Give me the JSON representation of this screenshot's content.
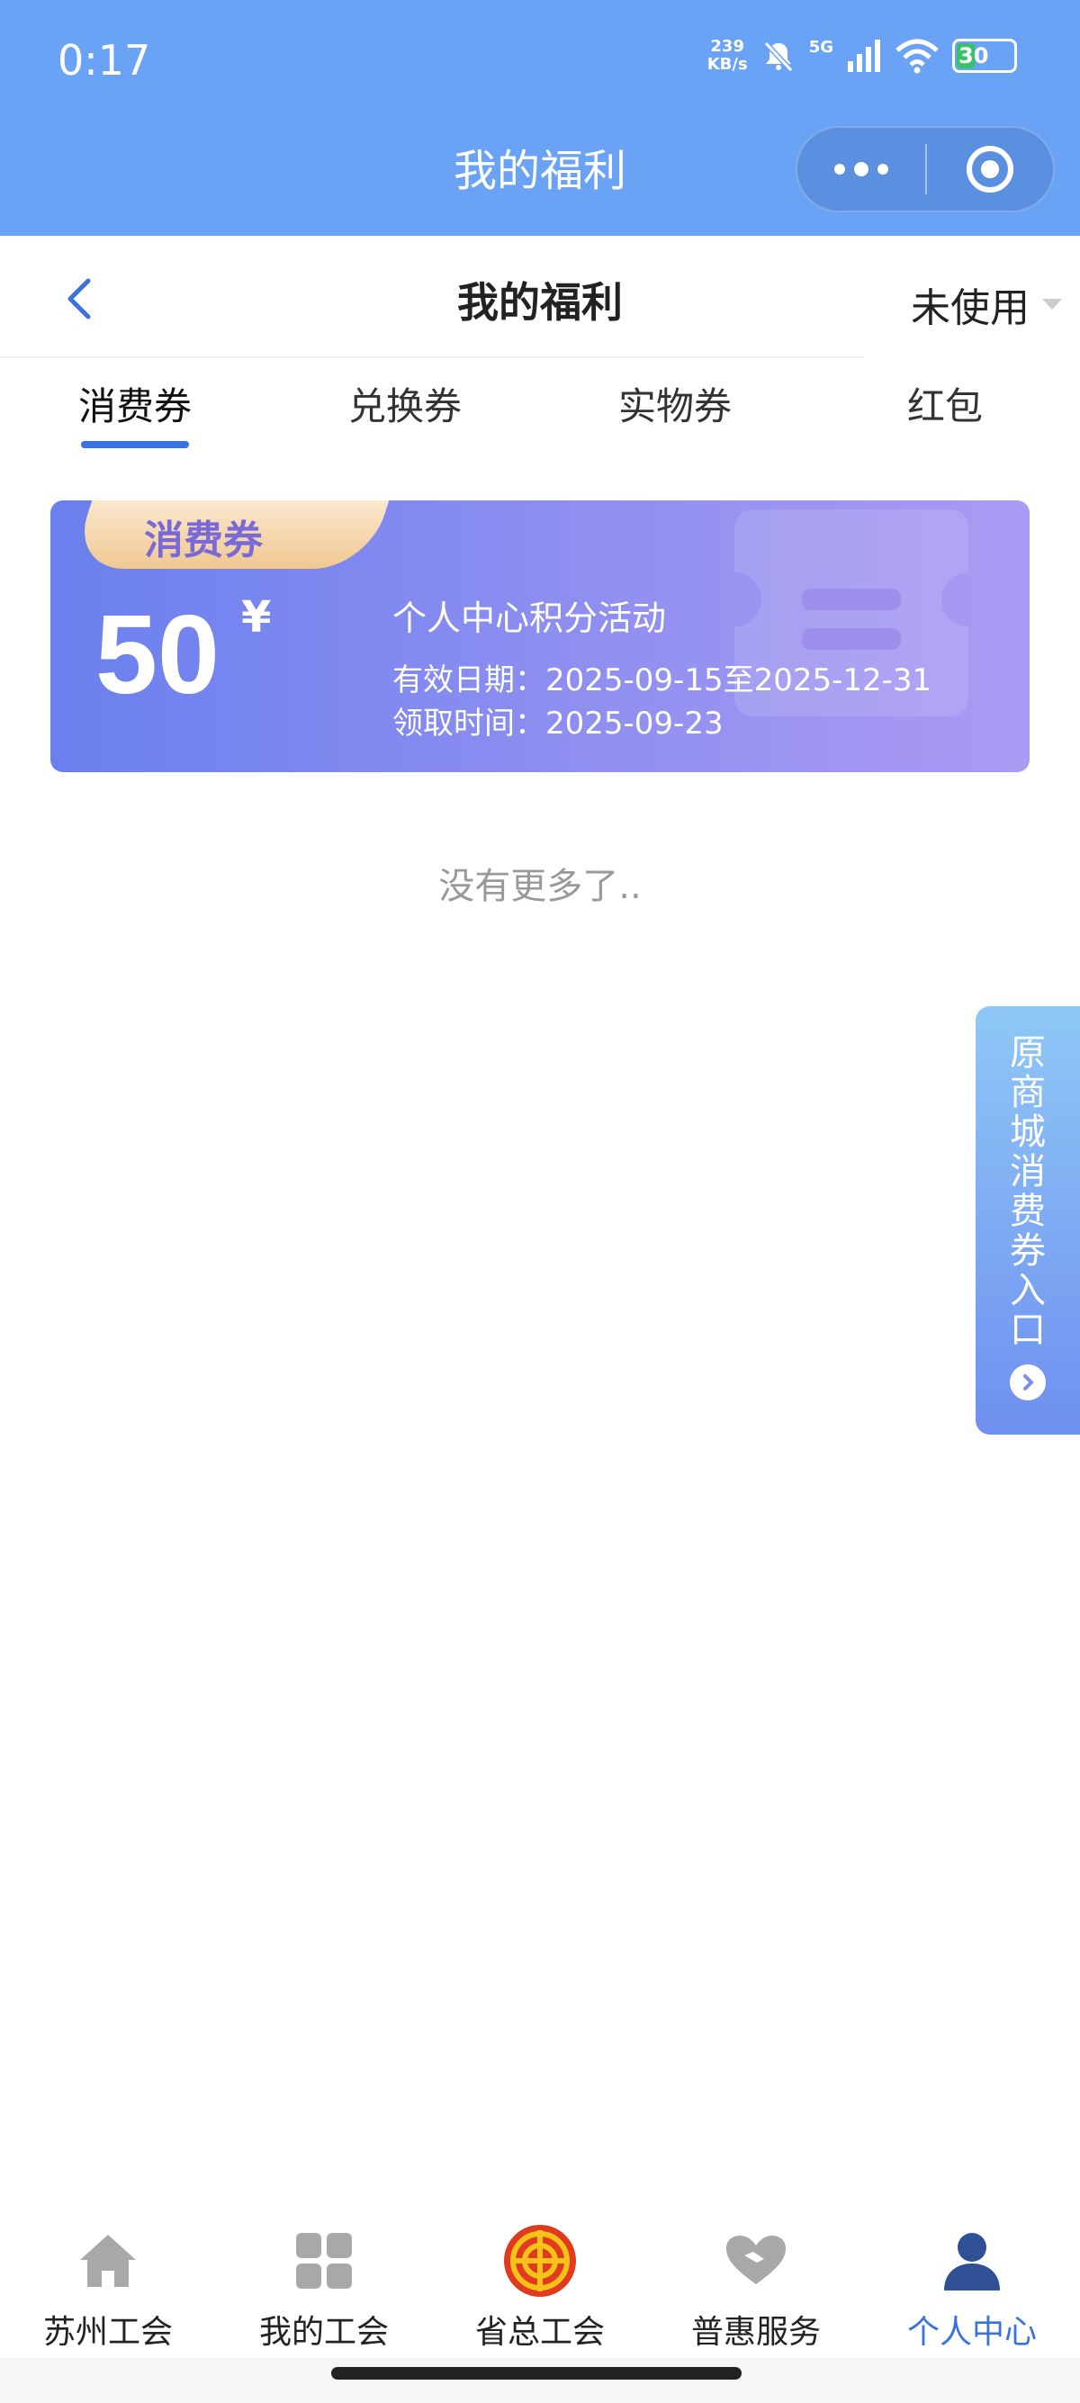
{
  "status_bar": {
    "time": "0:17",
    "net_speed_top": "239",
    "net_speed_bottom": "KB/s",
    "network": "5G",
    "battery": "30"
  },
  "header": {
    "title": "我的福利"
  },
  "nav": {
    "title": "我的福利",
    "filter_label": "未使用"
  },
  "tabs": [
    {
      "label": "消费券"
    },
    {
      "label": "兑换券"
    },
    {
      "label": "实物券"
    },
    {
      "label": "红包"
    }
  ],
  "coupon": {
    "tag": "消费券",
    "amount": "50",
    "currency": "¥",
    "name": "个人中心积分活动",
    "valid": "有效日期：2025-09-15至2025-12-31",
    "received": "领取时间：2025-09-23"
  },
  "list_end": "没有更多了..",
  "side_entry": {
    "label": "原商城消费券入口"
  },
  "bottom_tabs": [
    {
      "label": "苏州工会",
      "icon": "home-icon"
    },
    {
      "label": "我的工会",
      "icon": "grid-icon"
    },
    {
      "label": "省总工会",
      "icon": "union-logo-icon"
    },
    {
      "label": "普惠服务",
      "icon": "heart-hand-icon"
    },
    {
      "label": "个人中心",
      "icon": "person-icon"
    }
  ],
  "colors": {
    "header_blue": "#6aa3f5",
    "accent_blue": "#3a72e0",
    "coupon_start": "#6a80ee",
    "coupon_end": "#ab9af3"
  }
}
